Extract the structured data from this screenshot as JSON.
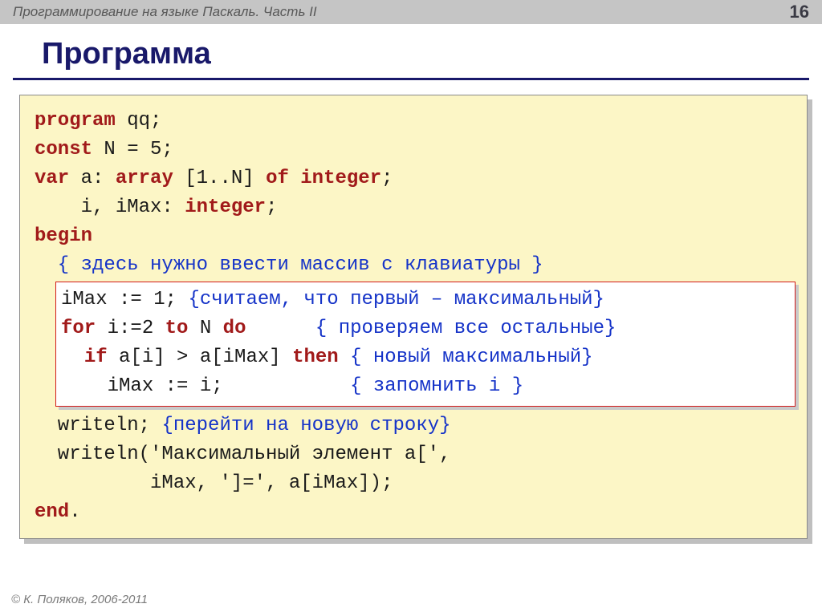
{
  "header": {
    "title": "Программирование на языке Паскаль. Часть II",
    "page": "16"
  },
  "slide": {
    "title": "Программа"
  },
  "code": {
    "l1_kw": "program",
    "l1_rest": " qq;",
    "l2_kw": "const",
    "l2_rest": " N = 5;",
    "l3_kw": "var",
    "l3_rest": " a: ",
    "l3_kw2": "array",
    "l3_rest2": " [1..N] ",
    "l3_kw3": "of",
    "l3_rest3": " ",
    "l3_kw4": "integer",
    "l3_rest4": ";",
    "l4_rest": "    i, iMax: ",
    "l4_kw": "integer",
    "l4_rest2": ";",
    "l5_kw": "begin",
    "l6_cm": "  { здесь нужно ввести массив с клавиатуры }",
    "h1": "iMax := 1; ",
    "h1_cm": "{считаем, что первый – максимальный}",
    "h2_kw": "for",
    "h2_a": " i:=2 ",
    "h2_kw2": "to",
    "h2_b": " N ",
    "h2_kw3": "do",
    "h2_pad": "      ",
    "h2_cm": "{ проверяем все остальные}",
    "h3_pad": "  ",
    "h3_kw": "if",
    "h3_a": " a[i] > a[iMax] ",
    "h3_kw2": "then",
    "h3_b": " ",
    "h3_cm": "{ новый максимальный}",
    "h4_pad": "    iMax := i;           ",
    "h4_cm": "{ запомнить i }",
    "l7_a": "  writeln; ",
    "l7_cm": "{перейти на новую строку}",
    "l8": "  writeln('Максимальный элемент a[',",
    "l9": "          iMax, ']=', a[iMax]);",
    "l10_kw": "end",
    "l10_rest": "."
  },
  "footer": "© К. Поляков, 2006-2011"
}
